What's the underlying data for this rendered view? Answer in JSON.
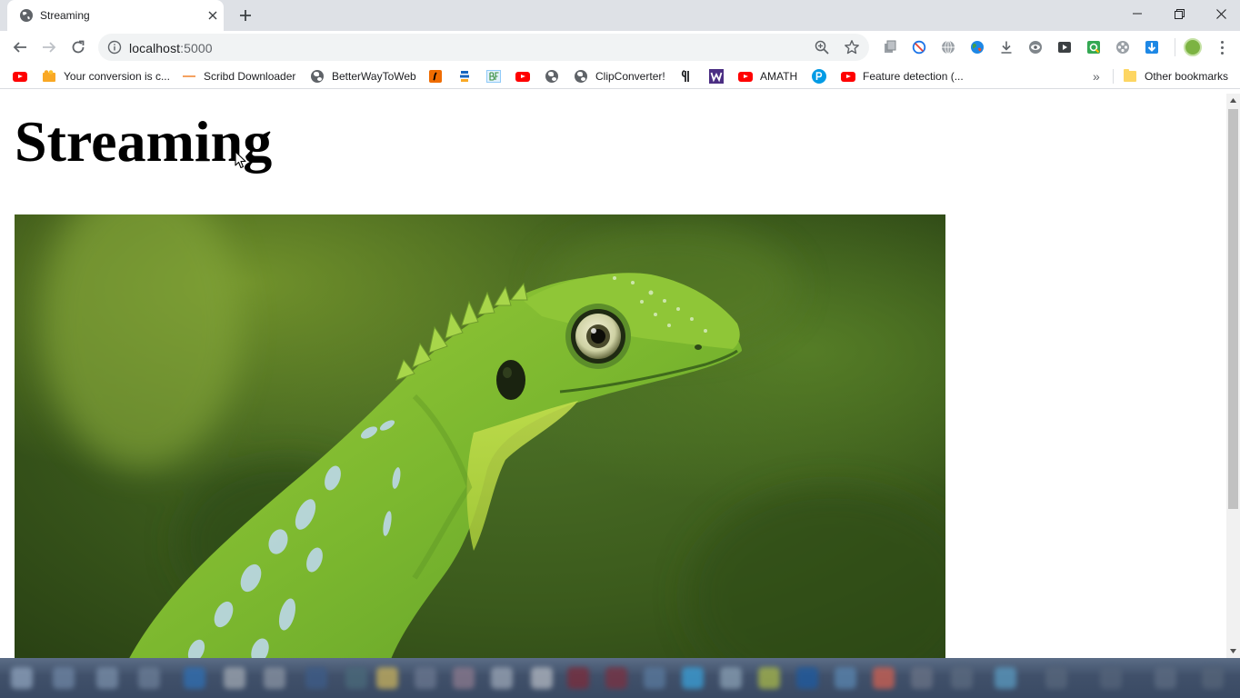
{
  "browser": {
    "tab": {
      "title": "Streaming",
      "favicon": "globe-icon"
    },
    "new_tab_icon": "plus-icon",
    "window_controls": [
      "minimize-icon",
      "restore-icon",
      "close-icon"
    ],
    "address": {
      "host": "localhost",
      "port": ":5000",
      "info_icon": "info-icon"
    },
    "extensions": [
      "reader-icon",
      "block-icon",
      "globe-icon",
      "earth-icon",
      "download-icon",
      "eye-icon",
      "cast-icon",
      "map-icon",
      "film-icon",
      "arrow-down-icon"
    ]
  },
  "bookmarks": {
    "items": [
      {
        "label": "",
        "icon": "youtube-icon"
      },
      {
        "label": "Your conversion is c...",
        "icon": "fan-icon"
      },
      {
        "label": "Scribd Downloader",
        "icon": "dash-icon"
      },
      {
        "label": "BetterWayToWeb",
        "icon": "globe-icon"
      },
      {
        "label": "",
        "icon": "app-orange-icon"
      },
      {
        "label": "",
        "icon": "stack-icon"
      },
      {
        "label": "",
        "icon": "bf-icon"
      },
      {
        "label": "",
        "icon": "youtube-icon"
      },
      {
        "label": "",
        "icon": "globe-icon"
      },
      {
        "label": "ClipConverter!",
        "icon": "globe-icon"
      },
      {
        "label": "",
        "icon": "pilcrow-icon"
      },
      {
        "label": "",
        "icon": "w-icon"
      },
      {
        "label": "AMATH",
        "icon": "youtube-icon"
      },
      {
        "label": "",
        "icon": "p-icon"
      },
      {
        "label": "Feature detection (...",
        "icon": "youtube-icon"
      }
    ],
    "more_label": "»",
    "other": {
      "label": "Other bookmarks",
      "icon": "folder-icon"
    }
  },
  "page": {
    "heading": "Streaming"
  },
  "colors": {
    "tabstrip": "#dee1e6",
    "youtube": "#ff0000",
    "lizard": "#8bc34a",
    "background_green": "#3d5d1c"
  }
}
